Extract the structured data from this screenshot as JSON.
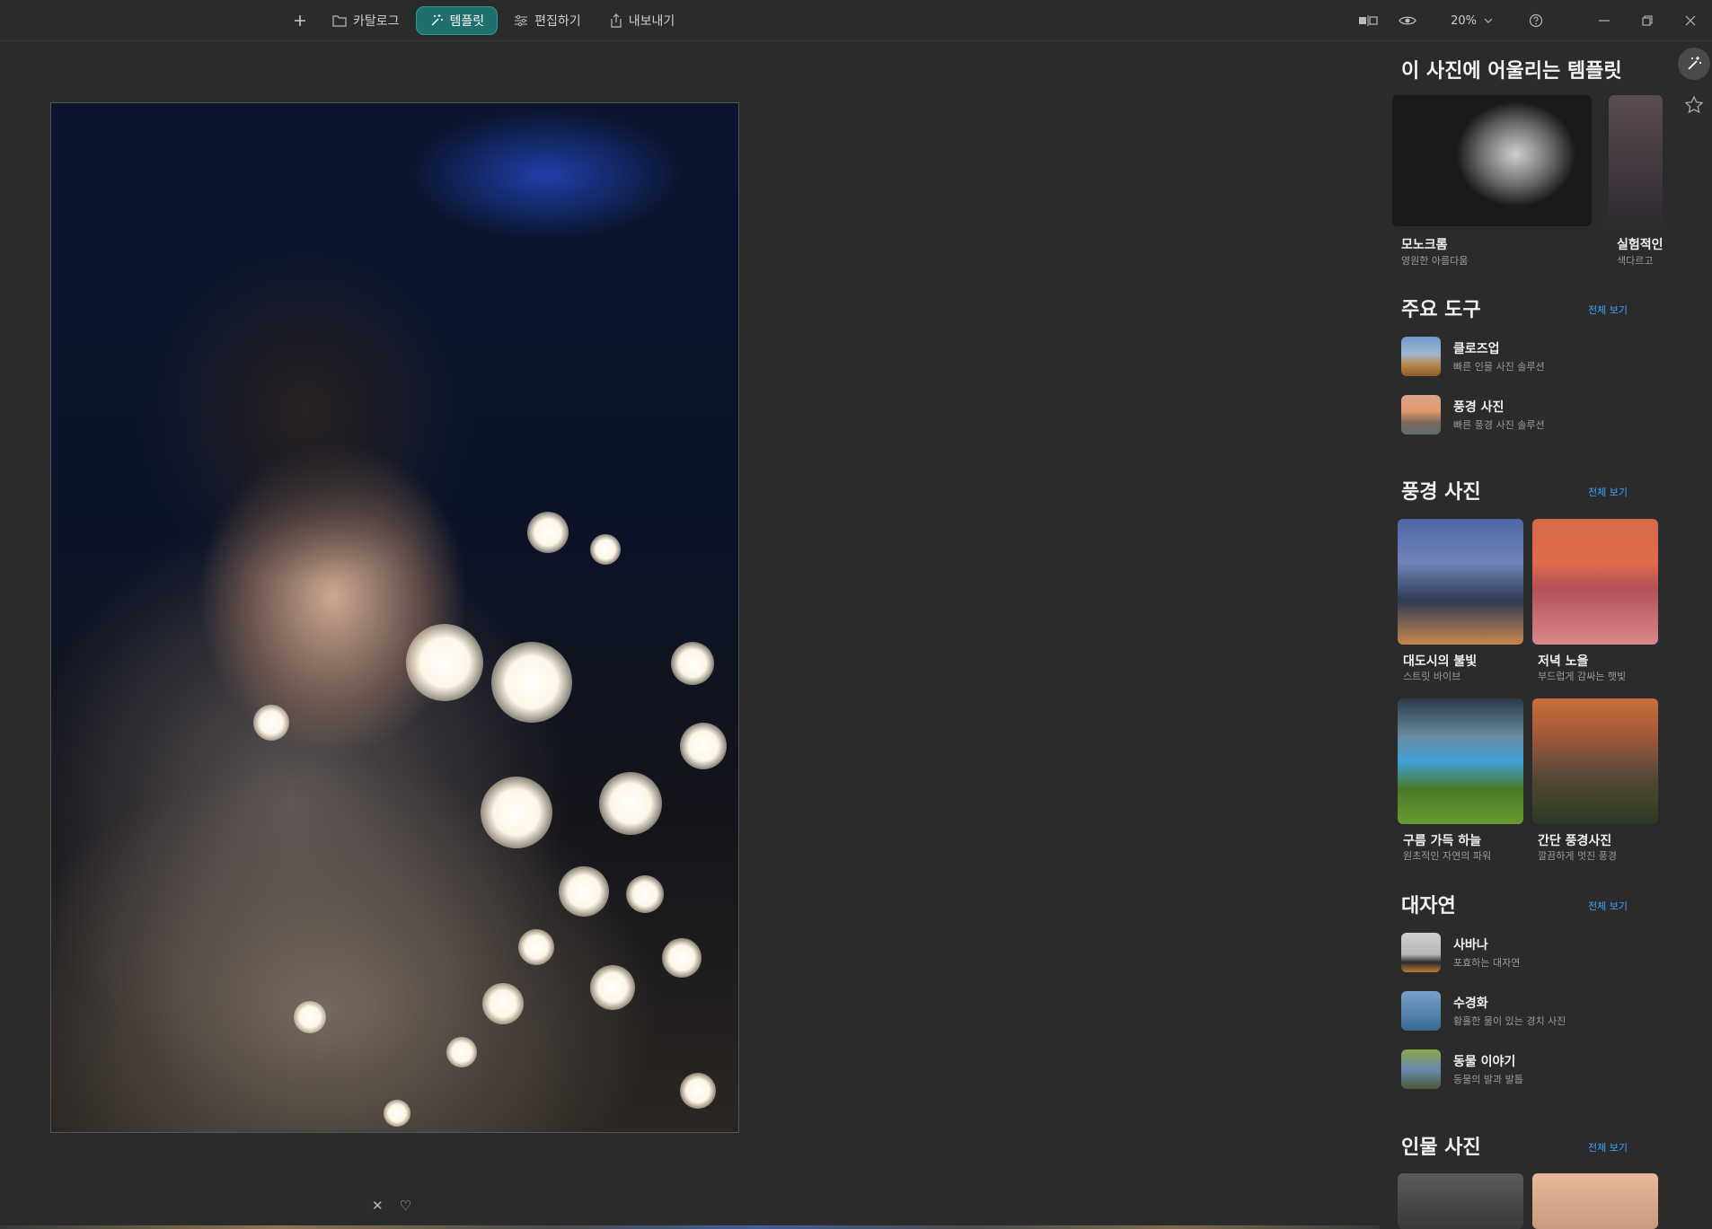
{
  "toolbar": {
    "nav": [
      {
        "label": "카탈로그",
        "icon": "folder-icon"
      },
      {
        "label": "템플릿",
        "icon": "magic-wand-icon",
        "active": true
      },
      {
        "label": "편집하기",
        "icon": "sliders-icon"
      },
      {
        "label": "내보내기",
        "icon": "export-icon"
      }
    ],
    "zoom": "20%"
  },
  "photo_actions": {
    "reject": "✕",
    "favorite": "♡"
  },
  "panel": {
    "suggested": {
      "title": "이 사진에 어울리는 템플릿",
      "items": [
        {
          "name": "모노크롬",
          "sub": "영원한 아름다움"
        },
        {
          "name": "실험적인",
          "sub": "색다르고"
        }
      ]
    },
    "main_tools": {
      "title": "주요 도구",
      "see_all": "전체 보기",
      "items": [
        {
          "name": "클로즈업",
          "sub": "빠른 인물 사진 솔루션"
        },
        {
          "name": "풍경 사진",
          "sub": "빠른 풍경 사진 솔루션"
        }
      ]
    },
    "landscape": {
      "title": "풍경 사진",
      "see_all": "전체 보기",
      "items": [
        {
          "name": "대도시의 불빛",
          "sub": "스트릿 바이브"
        },
        {
          "name": "저녁 노을",
          "sub": "부드럽게 감싸는 햇빛"
        },
        {
          "name": "구름 가득 하늘",
          "sub": "원초적인 자연의 파워"
        },
        {
          "name": "간단 풍경사진",
          "sub": "깔끔하게 멋진 풍경"
        }
      ]
    },
    "nature": {
      "title": "대자연",
      "see_all": "전체 보기",
      "items": [
        {
          "name": "사바나",
          "sub": "포효하는 대자연"
        },
        {
          "name": "수경화",
          "sub": "황홀한 물이 있는 경치 사진"
        },
        {
          "name": "동물 이야기",
          "sub": "동물의 발과 발톱"
        }
      ]
    },
    "portrait": {
      "title": "인물 사진",
      "see_all": "전체 보기"
    }
  },
  "colors": {
    "accent": "#1f6f6c",
    "link": "#3ea1ff",
    "background": "#2b2b2b"
  }
}
